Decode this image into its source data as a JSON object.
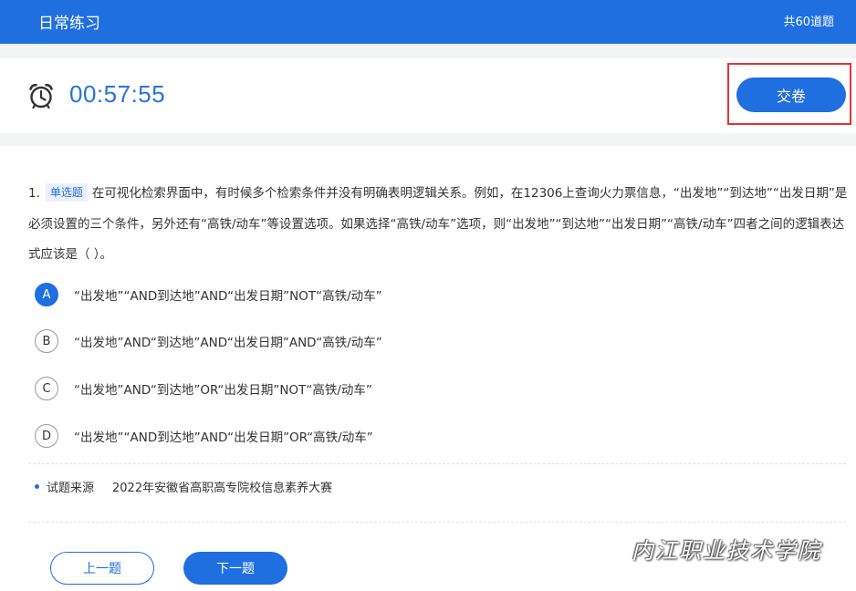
{
  "header": {
    "title": "日常练习",
    "count": "共60道题"
  },
  "timer": {
    "icon": "alarm-clock-icon",
    "value": "00:57:55"
  },
  "submit_label": "交卷",
  "question": {
    "number": "1.",
    "type": "单选题",
    "text": "在可视化检索界面中，有时候多个检索条件并没有明确表明逻辑关系。例如，在12306上查询火力票信息，“出发地”“到达地”“出发日期”是必须设置的三个条件，另外还有“高铁/动车”等设置选项。如果选择“高铁/动车”选项，则“出发地”“到达地”“出发日期”“高铁/动车”四者之间的逻辑表达式应该是（ ）。"
  },
  "options": [
    {
      "letter": "A",
      "text": "“出发地”“AND到达地”AND“出发日期”NOT“高铁/动车”",
      "selected": true
    },
    {
      "letter": "B",
      "text": "“出发地”AND“到达地”AND“出发日期”AND“高铁/动车”",
      "selected": false
    },
    {
      "letter": "C",
      "text": "“出发地”AND“到达地”OR“出发日期”NOT“高铁/动车”",
      "selected": false
    },
    {
      "letter": "D",
      "text": "“出发地”“AND到达地”AND“出发日期”OR“高铁/动车”",
      "selected": false
    }
  ],
  "source": {
    "label": "试题来源",
    "value": "2022年安徽省高职高专院校信息素养大赛"
  },
  "nav": {
    "prev_label": "上一题",
    "next_label": "下一题"
  },
  "watermark": "内江职业技术学院",
  "colors": {
    "accent": "#1f6fe0",
    "highlight_border": "#e03535"
  }
}
